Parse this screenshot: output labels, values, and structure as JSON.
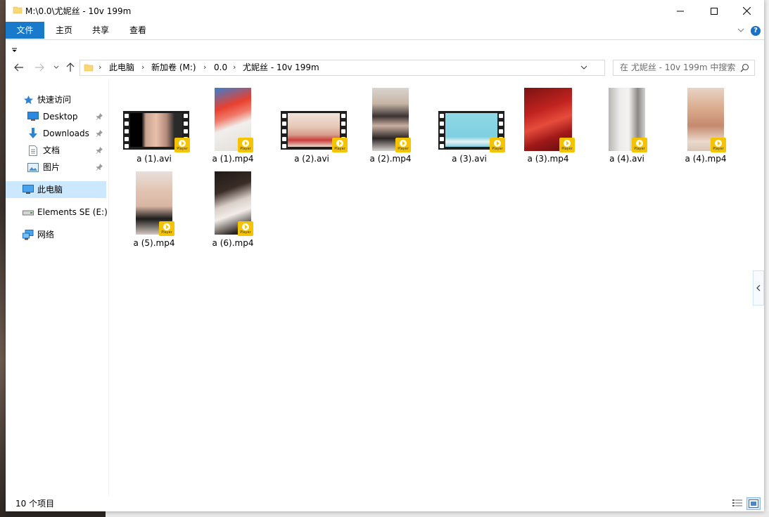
{
  "window": {
    "title": "M:\\0.0\\尤妮丝 - 10v 199m"
  },
  "ribbon": {
    "tabs": [
      {
        "label": "文件"
      },
      {
        "label": "主页"
      },
      {
        "label": "共享"
      },
      {
        "label": "查看"
      }
    ]
  },
  "address": {
    "crumbs": [
      {
        "label": "此电脑"
      },
      {
        "label": "新加卷 (M:)"
      },
      {
        "label": "0.0"
      },
      {
        "label": "尤妮丝 - 10v 199m"
      }
    ]
  },
  "search": {
    "placeholder": "在 尤妮丝 - 10v 199m 中搜索"
  },
  "sidebar": {
    "items": [
      {
        "label": "快速访问",
        "icon": "star-icon"
      },
      {
        "label": "Desktop",
        "icon": "desktop-icon",
        "pinned": true
      },
      {
        "label": "Downloads",
        "icon": "download-arrow-icon",
        "pinned": true
      },
      {
        "label": "文档",
        "icon": "document-icon",
        "pinned": true
      },
      {
        "label": "图片",
        "icon": "pictures-icon",
        "pinned": true
      },
      {
        "label": "此电脑",
        "icon": "this-pc-icon",
        "selected": true
      },
      {
        "label": "Elements SE (E:)",
        "icon": "drive-icon"
      },
      {
        "label": "网络",
        "icon": "network-icon"
      }
    ]
  },
  "files": [
    {
      "name": "a (1).avi",
      "kind": "avi"
    },
    {
      "name": "a (1).mp4",
      "kind": "mp4"
    },
    {
      "name": "a (2).avi",
      "kind": "avi"
    },
    {
      "name": "a (2).mp4",
      "kind": "mp4"
    },
    {
      "name": "a (3).avi",
      "kind": "avi"
    },
    {
      "name": "a (3).mp4",
      "kind": "mp4"
    },
    {
      "name": "a (4).avi",
      "kind": "avi"
    },
    {
      "name": "a (4).mp4",
      "kind": "mp4"
    },
    {
      "name": "a (5).mp4",
      "kind": "mp4"
    },
    {
      "name": "a (6).mp4",
      "kind": "mp4"
    }
  ],
  "badge": {
    "label": "Player"
  },
  "status": {
    "item_count": "10 个项目"
  },
  "colors": {
    "file_tab": "#1979ca",
    "selected_nav": "#cce8ff",
    "badge": "#f5c400"
  }
}
